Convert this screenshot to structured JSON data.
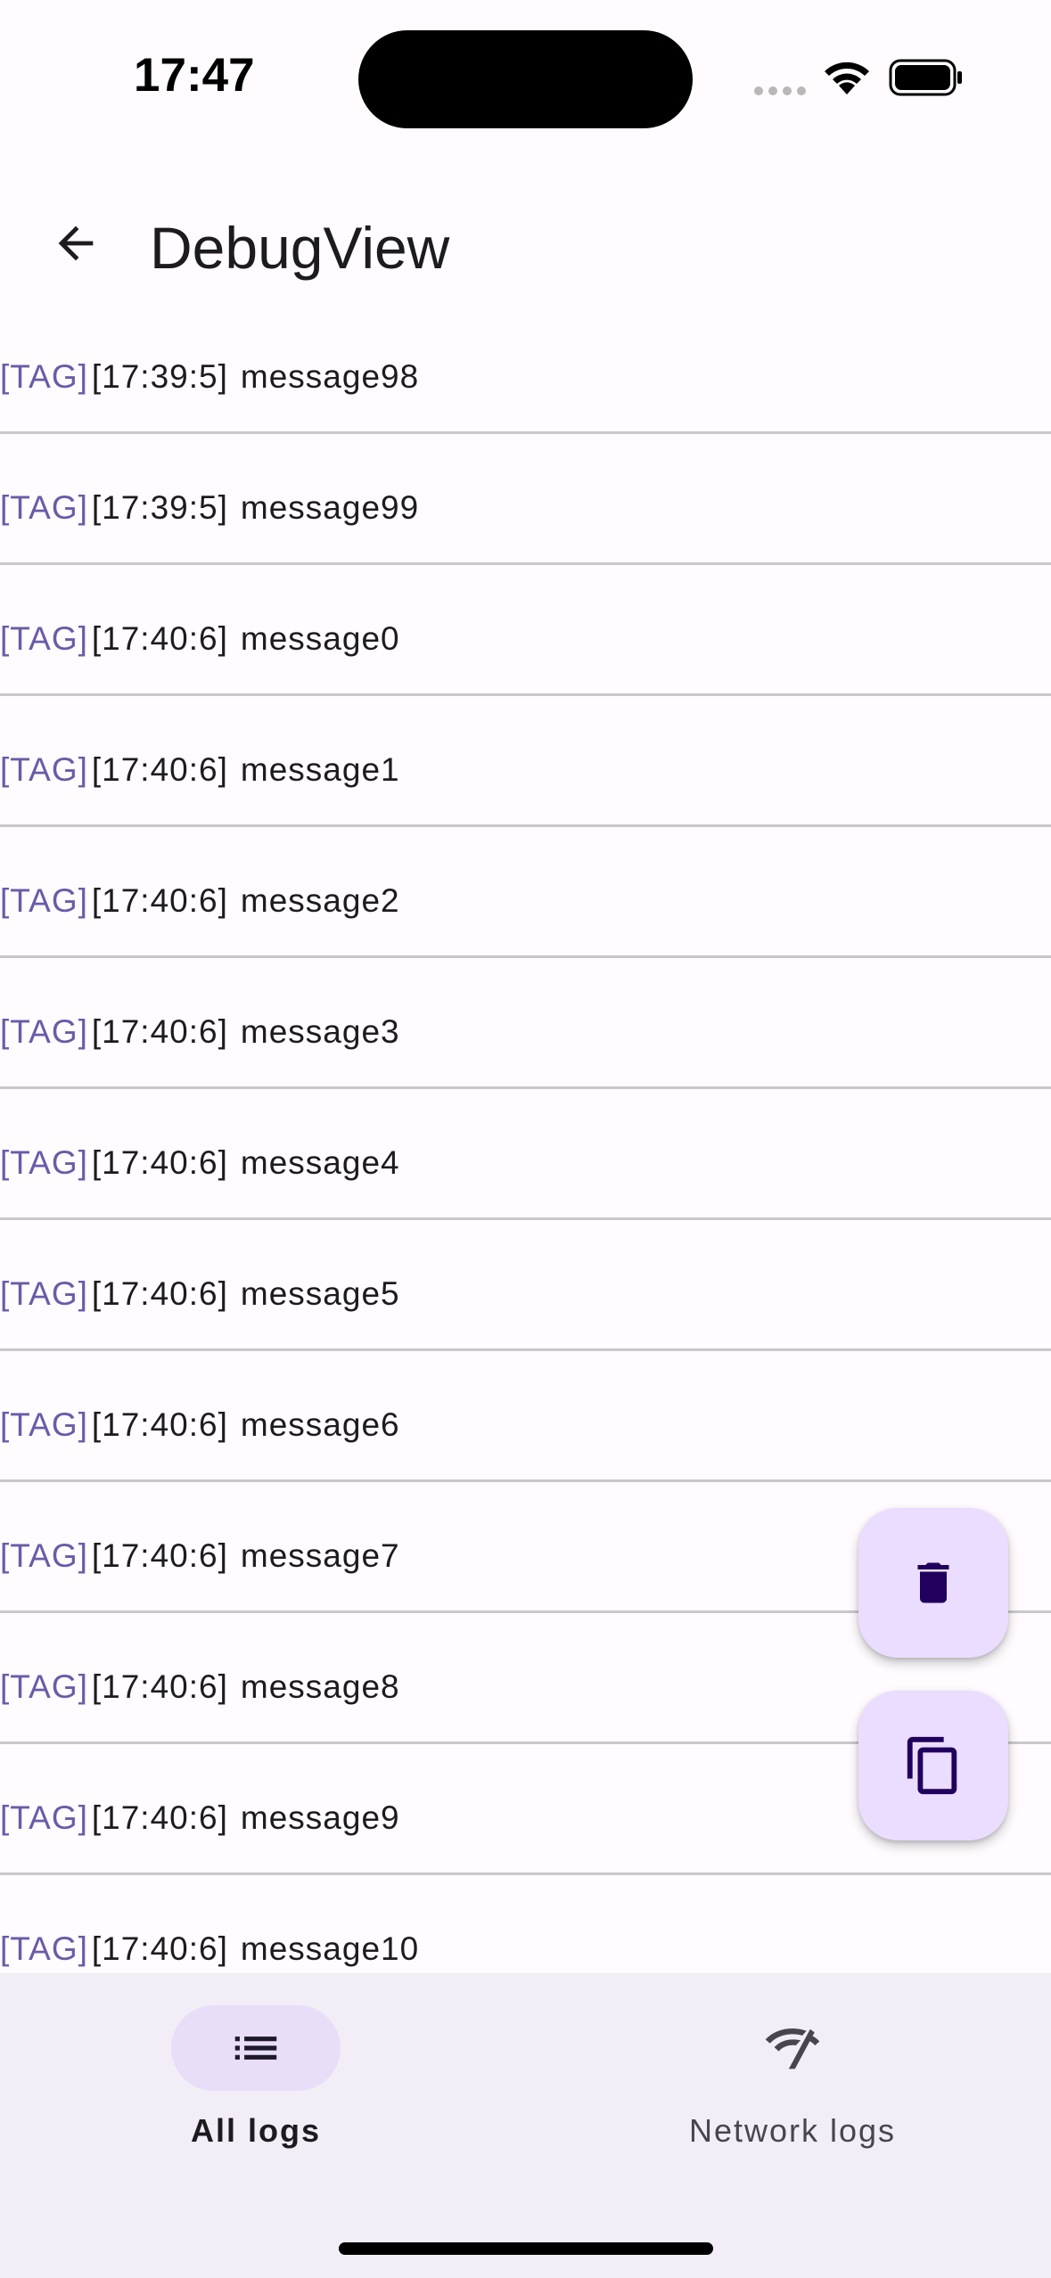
{
  "status_bar": {
    "time": "17:47"
  },
  "app_bar": {
    "title": "DebugView",
    "back_icon": "arrow-back-icon"
  },
  "logs": [
    {
      "tag": "[TAG]",
      "time": "[17:39:5]",
      "message": "message98"
    },
    {
      "tag": "[TAG]",
      "time": "[17:39:5]",
      "message": "message99"
    },
    {
      "tag": "[TAG]",
      "time": "[17:40:6]",
      "message": "message0"
    },
    {
      "tag": "[TAG]",
      "time": "[17:40:6]",
      "message": "message1"
    },
    {
      "tag": "[TAG]",
      "time": "[17:40:6]",
      "message": "message2"
    },
    {
      "tag": "[TAG]",
      "time": "[17:40:6]",
      "message": "message3"
    },
    {
      "tag": "[TAG]",
      "time": "[17:40:6]",
      "message": "message4"
    },
    {
      "tag": "[TAG]",
      "time": "[17:40:6]",
      "message": "message5"
    },
    {
      "tag": "[TAG]",
      "time": "[17:40:6]",
      "message": "message6"
    },
    {
      "tag": "[TAG]",
      "time": "[17:40:6]",
      "message": "message7"
    },
    {
      "tag": "[TAG]",
      "time": "[17:40:6]",
      "message": "message8"
    },
    {
      "tag": "[TAG]",
      "time": "[17:40:6]",
      "message": "message9"
    },
    {
      "tag": "[TAG]",
      "time": "[17:40:6]",
      "message": "message10"
    }
  ],
  "fabs": {
    "delete_icon": "trash-icon",
    "copy_icon": "copy-icon"
  },
  "bottom_nav": {
    "items": [
      {
        "label": "All logs",
        "icon": "list-icon",
        "selected": true
      },
      {
        "label": "Network logs",
        "icon": "network-icon",
        "selected": false
      }
    ]
  },
  "colors": {
    "background": "#fffbfe",
    "tag": "#6a5ba8",
    "fab": "#eaddff",
    "nav_background": "#f3edf7",
    "nav_indicator": "#e8def8",
    "icon_dark": "#21005d"
  }
}
